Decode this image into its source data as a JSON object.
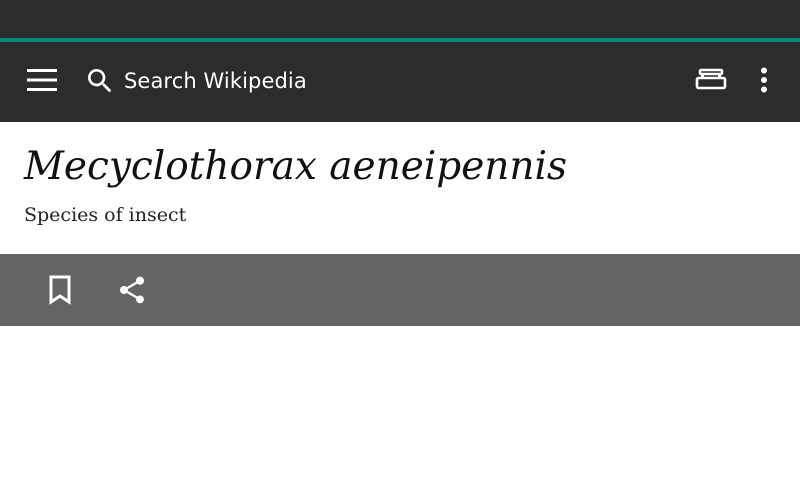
{
  "app": {
    "accent_color": "#00897b",
    "toolbar_color": "#2c2c2c",
    "action_bar_color": "#646464"
  },
  "toolbar": {
    "menu_icon": "hamburger-menu-icon",
    "search_icon": "search-icon",
    "search_placeholder": "Search Wikipedia",
    "reading_icon": "reading-lists-icon",
    "overflow_icon": "more-vert-icon"
  },
  "article": {
    "title": "Mecyclothorax aeneipennis",
    "description": "Species of insect"
  },
  "actions": {
    "bookmark_icon": "bookmark-icon",
    "share_icon": "share-icon"
  }
}
